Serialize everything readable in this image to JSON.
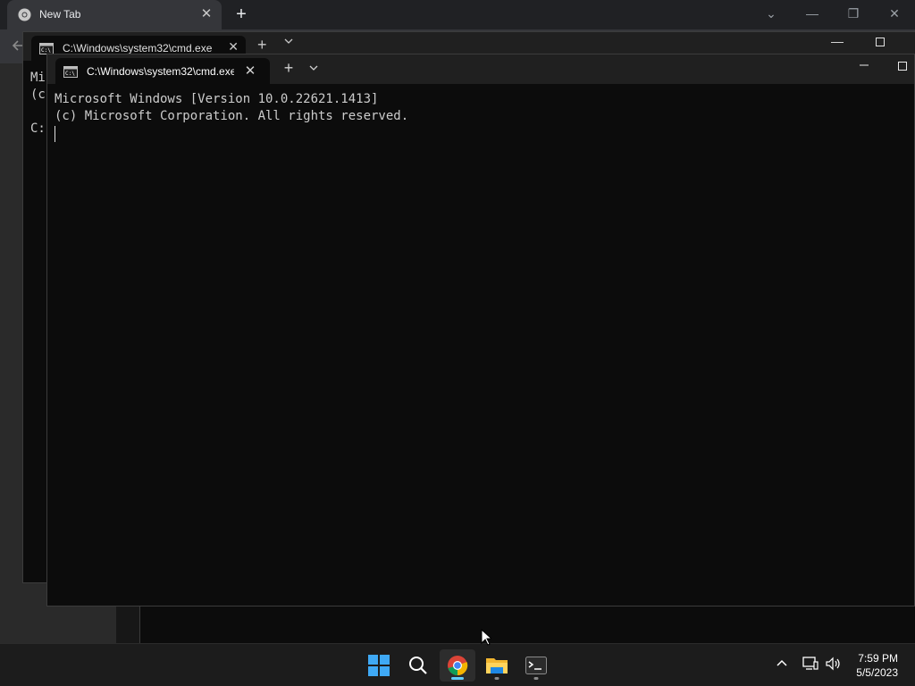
{
  "chrome": {
    "tab_title": "New Tab",
    "close_glyph": "✕",
    "newtab_glyph": "+",
    "controls": {
      "dropdown": "⌄",
      "minimize": "—",
      "restore": "❐",
      "close": "✕"
    }
  },
  "back_terminal": {
    "tab_title": "C:\\Windows\\system32\\cmd.exe",
    "close_glyph": "✕",
    "plus_glyph": "+",
    "minimize_glyph": "—",
    "lines": [
      "Mi",
      "(c",
      "",
      "C:"
    ]
  },
  "terminal": {
    "tab_title": "C:\\Windows\\system32\\cmd.exe",
    "close_glyph": "✕",
    "plus_glyph": "+",
    "line1": "Microsoft Windows [Version 10.0.22621.1413]",
    "line2": "(c) Microsoft Corporation. All rights reserved."
  },
  "taskbar": {
    "apps": [
      "start-button",
      "search-icon",
      "chrome-app",
      "file-explorer-app",
      "terminal-app"
    ],
    "time": "7:59 PM",
    "date": "5/5/2023",
    "accent": "#60cdff"
  }
}
